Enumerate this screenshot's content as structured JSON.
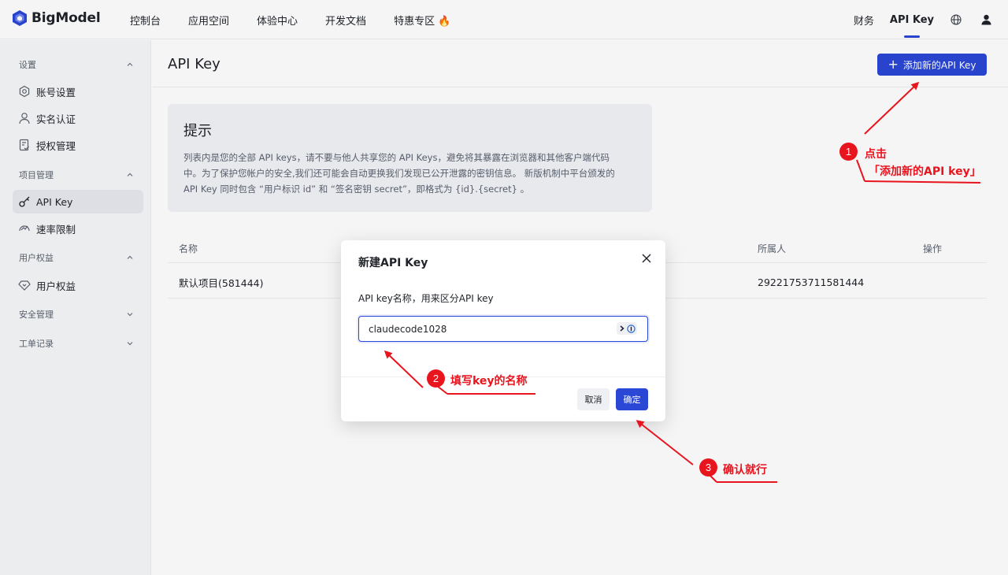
{
  "nav": {
    "logo": "BigModel",
    "items": [
      "控制台",
      "应用空间",
      "体验中心",
      "开发文档",
      "特惠专区 🔥"
    ],
    "finance": "财务",
    "apikey": "API Key"
  },
  "sidebar": {
    "groups": {
      "settings": "设置",
      "project": "项目管理",
      "rights": "用户权益",
      "security": "安全管理",
      "tickets": "工单记录"
    },
    "items": {
      "account": "账号设置",
      "realname": "实名认证",
      "auth": "授权管理",
      "apikey": "API Key",
      "ratelimit": "速率限制",
      "rights": "用户权益"
    }
  },
  "main": {
    "title": "API Key",
    "add_button": "添加新的API Key",
    "tip": {
      "title": "提示",
      "line1": "列表内是您的全部 API keys，请不要与他人共享您的 API Keys，避免将其暴露在浏览器和其他客户端代码",
      "line2": "中。为了保护您帐户的安全,我们还可能会自动更换我们发现已公开泄露的密钥信息。 新版机制中平台颁发的",
      "line3": "API Key 同时包含 “用户标识 id” 和 “签名密钥 secret”，即格式为 {id}.{secret} 。"
    },
    "table": {
      "headers": {
        "name": "名称",
        "owner": "所属人",
        "action": "操作"
      },
      "rows": [
        {
          "name": "默认项目(581444)",
          "owner": "29221753711581444"
        }
      ]
    }
  },
  "modal": {
    "title": "新建API Key",
    "label": "API key名称，用来区分API key",
    "input_value": "claudecode1028",
    "cancel": "取消",
    "ok": "确定"
  },
  "annotations": {
    "step1_num": "1",
    "step1_line1": "点击",
    "step1_line2": "「添加新的API key」",
    "step2_num": "2",
    "step2_text": "填写key的名称",
    "step3_num": "3",
    "step3_text": "确认就行",
    "color": "#e8141e"
  },
  "colors": {
    "primary": "#2a47d6",
    "sidebar_bg": "#f6f7f9"
  }
}
